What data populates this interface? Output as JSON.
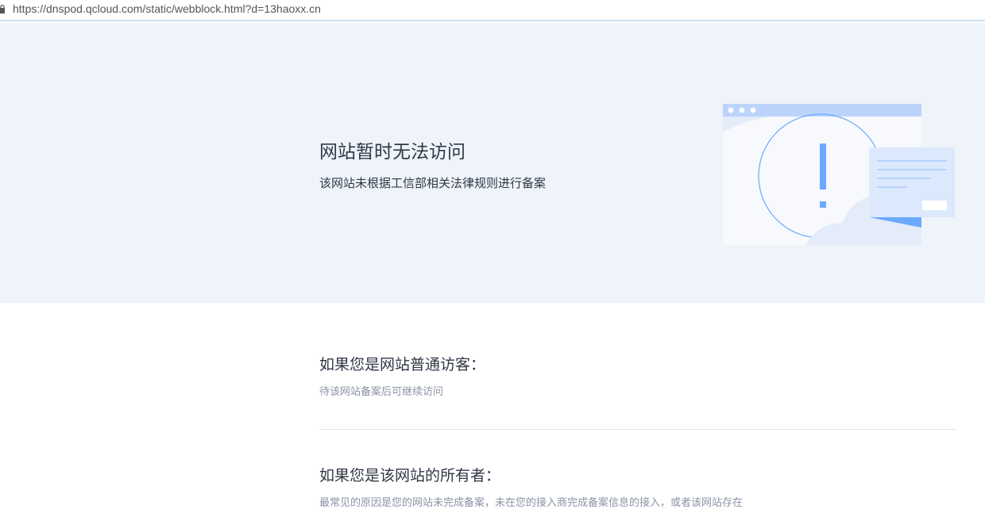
{
  "browser": {
    "url": "https://dnspod.qcloud.com/static/webblock.html?d=13haoxx.cn"
  },
  "hero": {
    "title": "网站暂时无法访问",
    "subtitle": "该网站未根据工信部相关法律规则进行备案"
  },
  "visitor": {
    "title": "如果您是网站普通访客：",
    "text": "待该网站备案后可继续访问"
  },
  "owner": {
    "title": "如果您是该网站的所有者：",
    "text": "最常见的原因是您的网站未完成备案，未在您的接入商完成备案信息的接入，或者该网站存在"
  },
  "colors": {
    "hero_bg": "#eff3fa",
    "accent_blue": "#6aa9ff",
    "title_text": "#303846",
    "muted_text": "#8a93a5"
  },
  "icons": [
    "lock-icon",
    "warning-illustration"
  ]
}
